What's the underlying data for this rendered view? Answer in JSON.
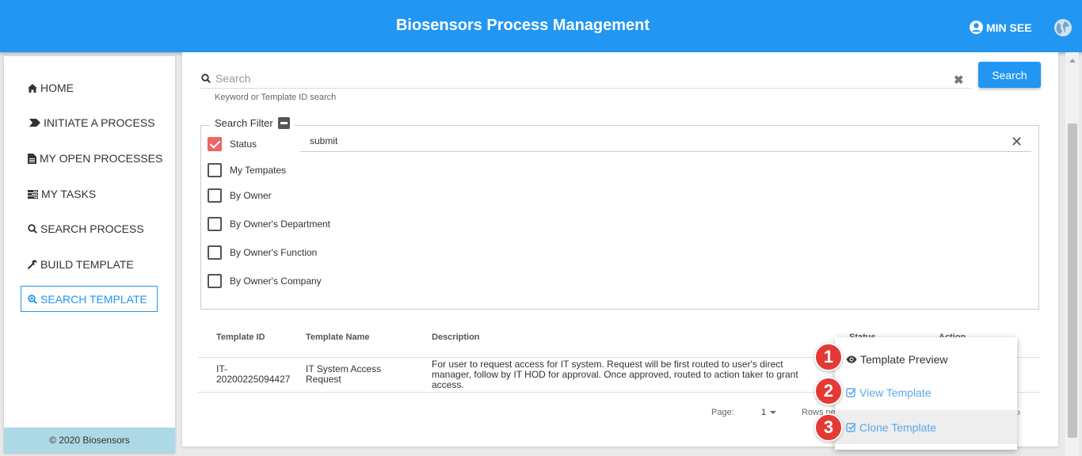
{
  "header": {
    "title": "Biosensors Process Management",
    "user_name": "MIN SEE"
  },
  "sidebar": {
    "items": [
      {
        "label": "HOME",
        "icon": "home-icon"
      },
      {
        "label": "INITIATE A PROCESS",
        "icon": "chevron-tag-icon"
      },
      {
        "label": "MY OPEN PROCESSES",
        "icon": "file-icon"
      },
      {
        "label": "MY TASKS",
        "icon": "tasks-icon"
      },
      {
        "label": "SEARCH PROCESS",
        "icon": "search-icon"
      },
      {
        "label": "BUILD TEMPLATE",
        "icon": "wrench-icon"
      },
      {
        "label": "SEARCH TEMPLATE",
        "icon": "search-plus-icon",
        "active": true
      }
    ],
    "footer": "© 2020 Biosensors"
  },
  "search": {
    "placeholder": "Search",
    "value": "",
    "help_text": "Keyword or Template ID search",
    "button_label": "Search"
  },
  "filter": {
    "legend": "Search Filter",
    "options": [
      {
        "label": "Status",
        "checked": true
      },
      {
        "label": "My Tempates",
        "checked": false
      },
      {
        "label": "By Owner",
        "checked": false
      },
      {
        "label": "By Owner's Department",
        "checked": false
      },
      {
        "label": "By Owner's Function",
        "checked": false
      },
      {
        "label": "By Owner's Company",
        "checked": false
      }
    ],
    "status_value": "submit"
  },
  "table": {
    "columns": [
      "Template ID",
      "Template Name",
      "Description",
      "Status",
      "Action"
    ],
    "rows": [
      {
        "id_line1": "IT-",
        "id_line2": "20200225094427",
        "name_line1": "IT System Access",
        "name_line2": "Request",
        "desc_line1": "For user to request access for IT system. Request will be first routed to user's direct",
        "desc_line2": "manager, follow by IT HOD for approval. Once approved, routed to action taker to grant",
        "desc_line3": "access."
      }
    ],
    "pager": {
      "page_label": "Page:",
      "page_value": "1",
      "rows_label": "Rows pe"
    }
  },
  "action_menu": {
    "items": [
      {
        "label": "Template Preview",
        "icon": "eye-icon",
        "badge": "1"
      },
      {
        "label": "View Template",
        "icon": "check-square-icon",
        "badge": "2"
      },
      {
        "label": "Clone Template",
        "icon": "check-square-icon",
        "badge": "3"
      }
    ]
  },
  "colors": {
    "primary": "#2196f3",
    "badge": "#e53935",
    "checkbox_checked": "#f06464",
    "footer_bg": "#add8e6"
  }
}
